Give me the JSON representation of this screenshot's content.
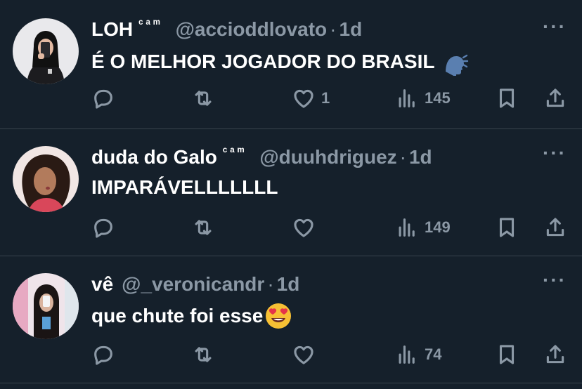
{
  "tweets": [
    {
      "name": "LOH",
      "badge": "ᶜᵃᵐ",
      "handle": "@accioddlovato",
      "time": "1d",
      "text": "É O MELHOR JOGADOR DO BRASIL",
      "emoji": "speaking-head",
      "likes": "1",
      "views": "145"
    },
    {
      "name": "duda do Galo",
      "badge": "ᶜᵃᵐ",
      "handle": "@duuhdriguez",
      "time": "1d",
      "text": "IMPARÁVELLLLLLL",
      "likes": "",
      "views": "149"
    },
    {
      "name": "vê",
      "badge": "",
      "handle": "@_veronicandr",
      "time": "1d",
      "text": "que chute foi esse",
      "emoji": "heart-eyes",
      "likes": "",
      "views": "74"
    }
  ],
  "separator": "·",
  "more_label": "···",
  "colors": {
    "background": "#15202b",
    "muted": "#8b98a5",
    "divider": "#38444d",
    "text": "#ffffff"
  }
}
